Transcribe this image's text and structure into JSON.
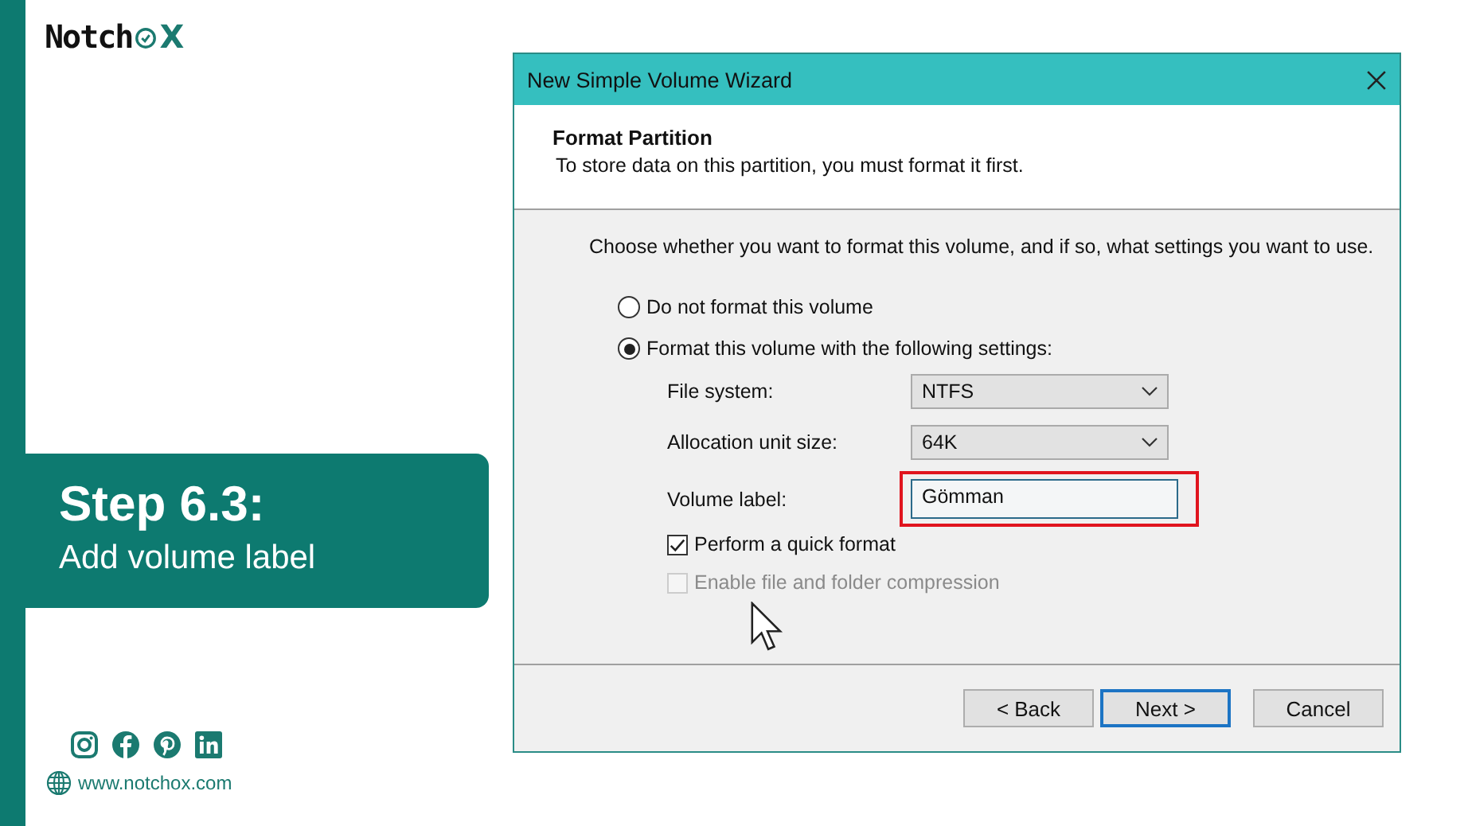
{
  "logo": {
    "text_before": "Notch",
    "text_after": "X"
  },
  "step_card": {
    "title": "Step 6.3:",
    "subtitle": "Add volume label"
  },
  "website": "www.notchox.com",
  "dialog": {
    "title": "New Simple Volume Wizard",
    "header": {
      "title": "Format Partition",
      "subtitle": "To store data on this partition, you must format it first."
    },
    "instruction": "Choose whether you want to format this volume, and if so, what settings you want to use.",
    "radios": [
      {
        "label": "Do not format this volume",
        "selected": false
      },
      {
        "label": "Format this volume with the following settings:",
        "selected": true
      }
    ],
    "fields": [
      {
        "kind": "dropdown",
        "label": "File system:",
        "value": "NTFS",
        "highlighted": false
      },
      {
        "kind": "dropdown",
        "label": "Allocation unit size:",
        "value": "64K",
        "highlighted": false
      },
      {
        "kind": "text",
        "label": "Volume label:",
        "value": "Gömman",
        "highlighted": true
      }
    ],
    "checkboxes": [
      {
        "label": "Perform a quick format",
        "checked": true,
        "disabled": false
      },
      {
        "label": "Enable file and folder compression",
        "checked": false,
        "disabled": true
      }
    ],
    "buttons": [
      {
        "label": "< Back",
        "default": false
      },
      {
        "label": "Next >",
        "default": true
      },
      {
        "label": "Cancel",
        "default": false
      }
    ]
  }
}
